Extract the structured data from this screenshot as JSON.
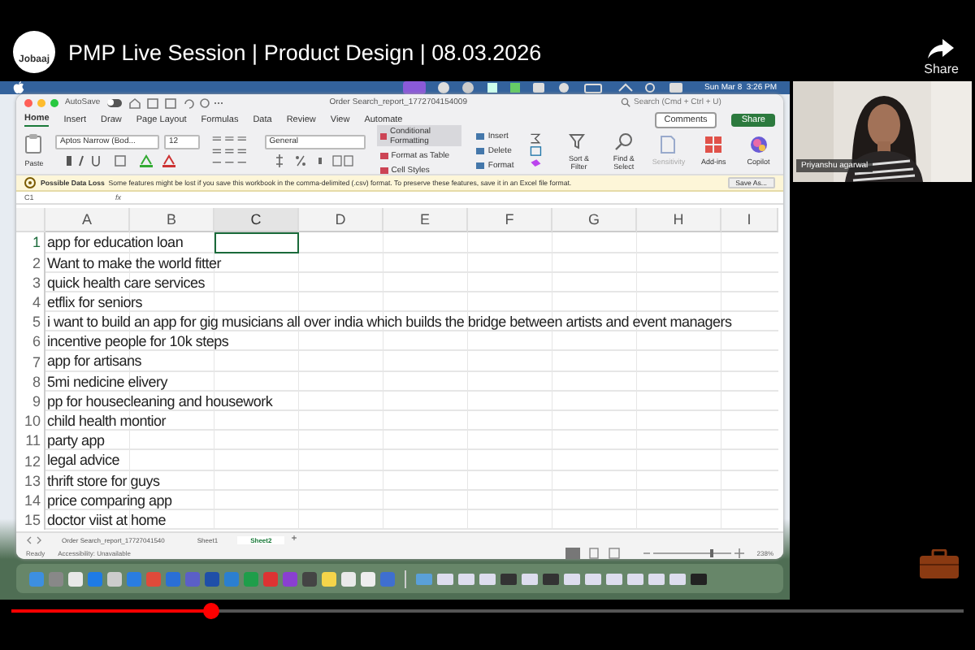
{
  "video": {
    "logo": "Jobaaj",
    "title": "PMP Live Session | Product Design | 08.03.2026",
    "share": "Share",
    "progress": {
      "level": 0.21
    }
  },
  "menubar": {
    "clock": "Sun Mar 8  3:26 PM"
  },
  "excel": {
    "autosave": {
      "label": "AutoSave",
      "on": false
    },
    "title": "Order Search_report_1772704154009",
    "search": {
      "placeholder": "Search (Cmd + Ctrl + U)"
    },
    "tabs": [
      {
        "label": "Home",
        "selected": true
      },
      {
        "label": "Insert",
        "selected": false
      },
      {
        "label": "Draw",
        "selected": false
      },
      {
        "label": "Page Layout",
        "selected": false
      },
      {
        "label": "Formulas",
        "selected": false
      },
      {
        "label": "Data",
        "selected": false
      },
      {
        "label": "Review",
        "selected": false
      },
      {
        "label": "View",
        "selected": false
      },
      {
        "label": "Automate",
        "selected": false
      }
    ],
    "comments": "Comments",
    "share": "Share",
    "ribbon": {
      "paste": "Paste",
      "font": "Aptos Narrow (Bod...",
      "size": "12",
      "number_format": "General",
      "styles": [
        "Conditional Formatting",
        "Format as Table",
        "Cell Styles"
      ],
      "cells": [
        "Insert",
        "Delete",
        "Format"
      ],
      "tools": [
        "Sort & Filter",
        "Find & Select",
        "Sensitivity",
        "Add-ins",
        "Copilot"
      ]
    },
    "warning": {
      "title": "Possible Data Loss",
      "message": "Some features might be lost if you save this workbook in the comma-delimited (.csv) format. To preserve these features, save it in an Excel file format.",
      "button": "Save As..."
    },
    "name_box": "C1",
    "formula_label": "fx",
    "columns": [
      {
        "label": "A",
        "selected": false
      },
      {
        "label": "B",
        "selected": false
      },
      {
        "label": "C",
        "selected": true
      },
      {
        "label": "D",
        "selected": false
      },
      {
        "label": "E",
        "selected": false
      },
      {
        "label": "F",
        "selected": false
      },
      {
        "label": "G",
        "selected": false
      },
      {
        "label": "H",
        "selected": false
      },
      {
        "label": "I",
        "selected": false
      }
    ],
    "rows": [
      {
        "number": "1",
        "text": "app for education loan",
        "selected": true
      },
      {
        "number": "2",
        "text": "Want to make the world fitter",
        "selected": false
      },
      {
        "number": "3",
        "text": "quick health care services",
        "selected": false
      },
      {
        "number": "4",
        "text": "etflix for seniors",
        "selected": false
      },
      {
        "number": "5",
        "text": "i want to build an app for gig musicians all over india which builds the bridge between artists and event managers",
        "selected": false
      },
      {
        "number": "6",
        "text": "incentive people for 10k steps",
        "selected": false
      },
      {
        "number": "7",
        "text": "app for artisans",
        "selected": false
      },
      {
        "number": "8",
        "text": "5mi nedicine elivery",
        "selected": false
      },
      {
        "number": "9",
        "text": "pp for housecleaning and housework",
        "selected": false
      },
      {
        "number": "10",
        "text": "child health montior",
        "selected": false
      },
      {
        "number": "11",
        "text": "party app",
        "selected": false
      },
      {
        "number": "12",
        "text": "legal advice",
        "selected": false
      },
      {
        "number": "13",
        "text": "thrift store for guys",
        "selected": false
      },
      {
        "number": "14",
        "text": "price comparing app",
        "selected": false
      },
      {
        "number": "15",
        "text": "doctor viist at home",
        "selected": false
      }
    ],
    "sheets": [
      {
        "label": "Order Search_report_17727041540",
        "selected": false
      },
      {
        "label": "Sheet1",
        "selected": false
      },
      {
        "label": "Sheet2",
        "selected": true
      }
    ],
    "add_sheet": "+",
    "zoom_slider": {
      "level": 0.75
    },
    "status": "Ready",
    "accessibility": "Accessibility: Unavailable",
    "zoom": "238%"
  },
  "participant": {
    "name": "Priyanshu agarwal"
  }
}
